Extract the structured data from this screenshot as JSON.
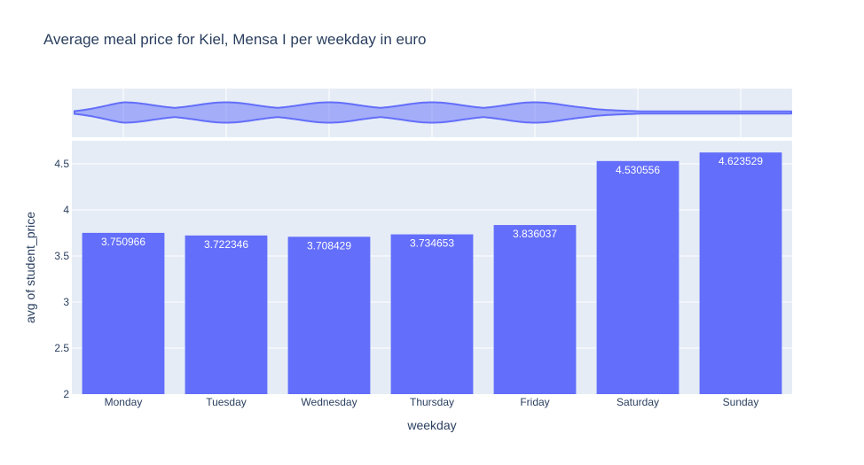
{
  "chart_data": {
    "type": "bar",
    "title": "Average meal price for Kiel, Mensa I per weekday in euro",
    "xlabel": "weekday",
    "ylabel": "avg of student_price",
    "categories": [
      "Monday",
      "Tuesday",
      "Wednesday",
      "Thursday",
      "Friday",
      "Saturday",
      "Sunday"
    ],
    "values": [
      3.750966,
      3.722346,
      3.708429,
      3.734653,
      3.836037,
      4.530556,
      4.623529
    ],
    "value_labels": [
      "3.750966",
      "3.722346",
      "3.708429",
      "3.734653",
      "3.836037",
      "4.530556",
      "4.623529"
    ],
    "ylim": [
      2,
      4.75
    ],
    "yticks": [
      2,
      2.5,
      3,
      3.5,
      4,
      4.5
    ],
    "ytick_labels": [
      "2",
      "2.5",
      "3",
      "3.5",
      "4",
      "4.5"
    ],
    "grid": true,
    "marginal": {
      "type": "violin",
      "orientation": "horizontal",
      "axis": "weekday"
    },
    "colors": {
      "bar": "#636efa",
      "plot_bg": "#e5ecf6",
      "grid": "#ffffff",
      "text": "#2a3f5f",
      "violin_line": "#636efa",
      "violin_fill": "rgba(99,110,250,0.5)"
    }
  }
}
